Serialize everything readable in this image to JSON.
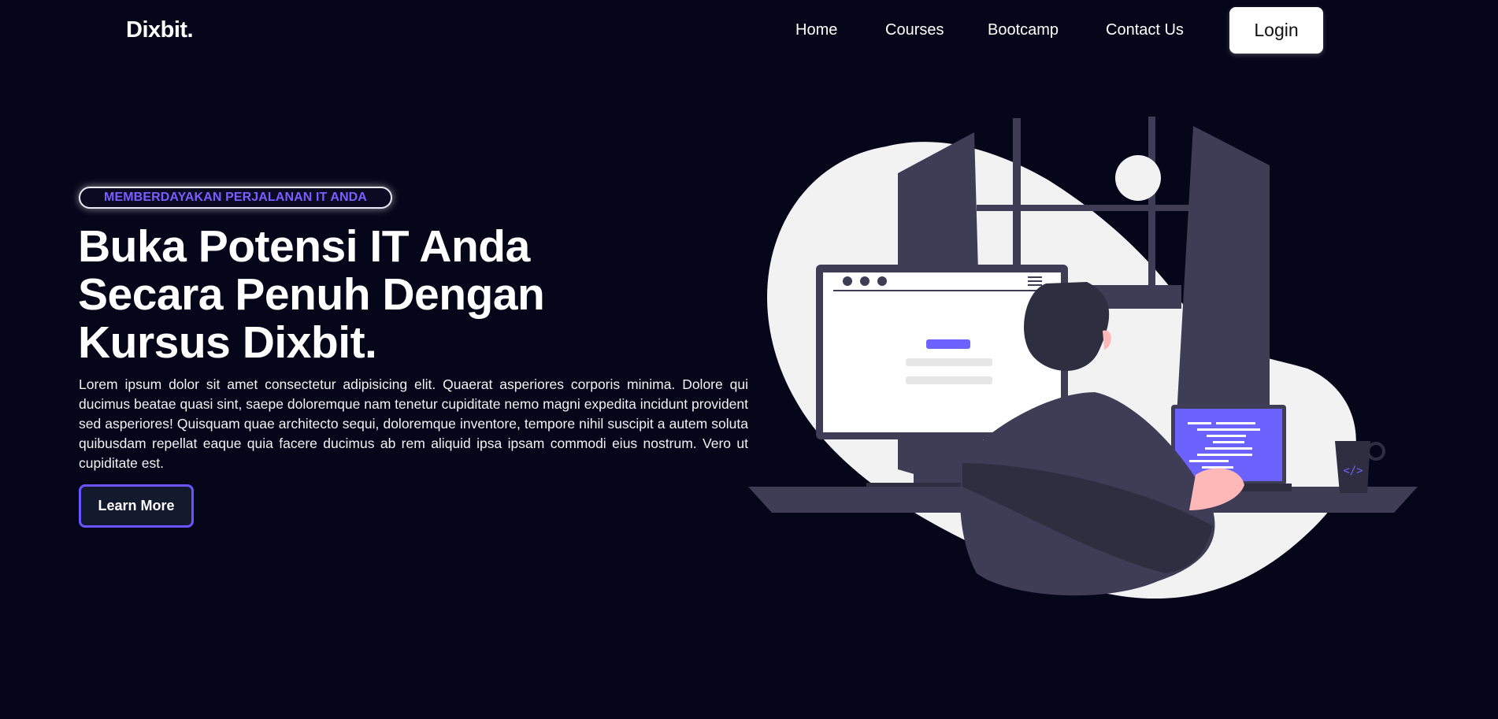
{
  "nav": {
    "logo": "Dixbit.",
    "links": [
      "Home",
      "Courses",
      "Bootcamp",
      "Contact Us"
    ],
    "login": "Login"
  },
  "hero": {
    "tagline": "MEMBERDAYAKAN PERJALANAN IT ANDA",
    "title_lines": [
      "Buka Potensi IT Anda",
      "Secara Penuh Dengan",
      "Kursus Dixbit."
    ],
    "description": "Lorem ipsum dolor sit amet consectetur adipisicing elit. Quaerat asperiores corporis minima. Dolore qui ducimus beatae quasi sint, saepe doloremque nam tenetur cupiditate nemo magni expedita incidunt provident sed asperiores! Quisquam quae architecto sequi, doloremque inventore, tempore nihil suscipit a autem soluta quibusdam repellat eaque quia facere ducimus ab rem aliquid ipsa ipsam commodi eius nostrum. Vero ut cupiditate est.",
    "cta": "Learn More"
  },
  "illustration": {
    "name": "developer-at-desk-illustration",
    "mug_icon": "</>"
  },
  "colors": {
    "background": "#05061a",
    "accent": "#6c63ff",
    "dark_shape": "#3f3d56",
    "light_shape": "#f2f2f2"
  }
}
